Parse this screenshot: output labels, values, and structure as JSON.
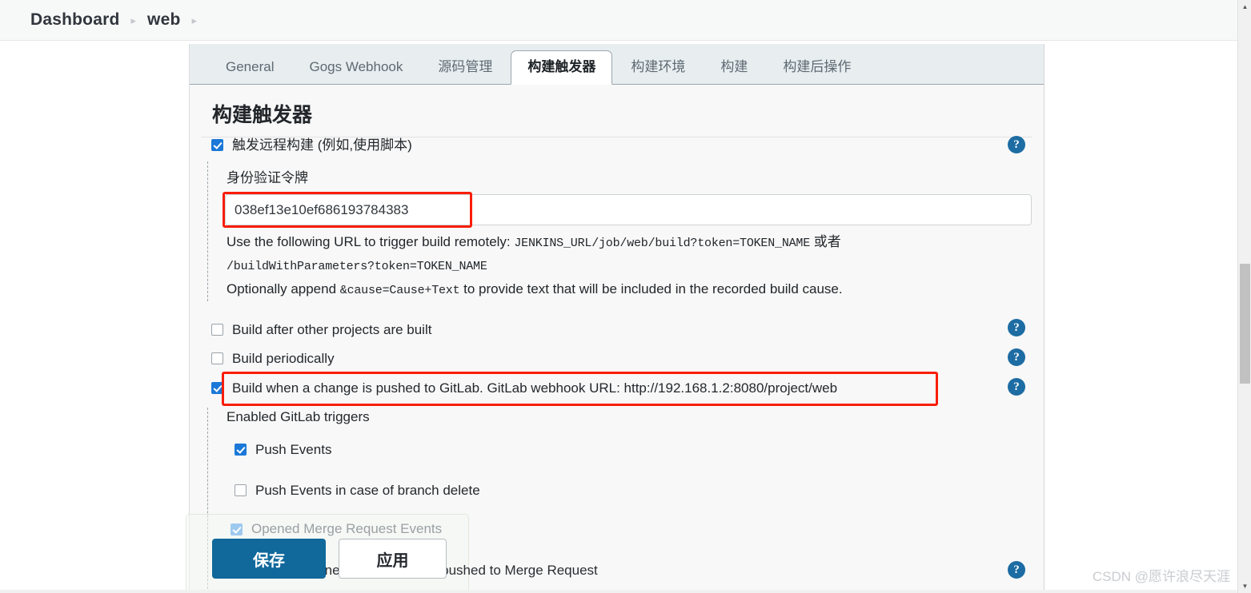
{
  "breadcrumb": {
    "items": [
      "Dashboard",
      "web"
    ],
    "separator": "▸"
  },
  "tabs": [
    {
      "label": "General",
      "active": false
    },
    {
      "label": "Gogs Webhook",
      "active": false
    },
    {
      "label": "源码管理",
      "active": false
    },
    {
      "label": "构建触发器",
      "active": true
    },
    {
      "label": "构建环境",
      "active": false
    },
    {
      "label": "构建",
      "active": false
    },
    {
      "label": "构建后操作",
      "active": false
    }
  ],
  "section": {
    "title": "构建触发器"
  },
  "triggers": {
    "remote": {
      "label": "触发远程构建 (例如,使用脚本)",
      "checked": true,
      "token_label": "身份验证令牌",
      "token_value": "038ef13e10ef686193784383",
      "help_line1_a": "Use the following URL to trigger build remotely: ",
      "help_line1_mono": "JENKINS_URL/job/web/build?token=TOKEN_NAME",
      "help_line1_b": " 或者",
      "help_line2_mono": "/buildWithParameters?token=TOKEN_NAME",
      "help_line3_a": "Optionally append ",
      "help_line3_mono": "&cause=Cause+Text",
      "help_line3_b": " to provide text that will be included in the recorded build cause."
    },
    "after_projects": {
      "label": "Build after other projects are built",
      "checked": false
    },
    "periodically": {
      "label": "Build periodically",
      "checked": false
    },
    "gitlab": {
      "label": "Build when a change is pushed to GitLab. GitLab webhook URL: http://192.168.1.2:8080/project/web",
      "checked": true,
      "enabled_label": "Enabled GitLab triggers",
      "events": [
        {
          "label": "Push Events",
          "checked": true
        },
        {
          "label": "Push Events in case of branch delete",
          "checked": false
        }
      ],
      "faded_events": [
        {
          "label": "Opened Merge Request Events",
          "checked": true
        },
        {
          "label": "Build only if new commits were pushed to Merge Request",
          "checked": false
        }
      ]
    }
  },
  "buttons": {
    "save": "保存",
    "apply": "应用"
  },
  "icons": {
    "help": "?",
    "scroll_up": "▲",
    "scroll_down": "▼"
  },
  "watermark": "CSDN @愿许浪尽天涯",
  "colors": {
    "accent_blue": "#1b78d8",
    "save_blue": "#10689b",
    "help_blue": "#1d6ca3",
    "highlight_red": "#f91d06"
  }
}
